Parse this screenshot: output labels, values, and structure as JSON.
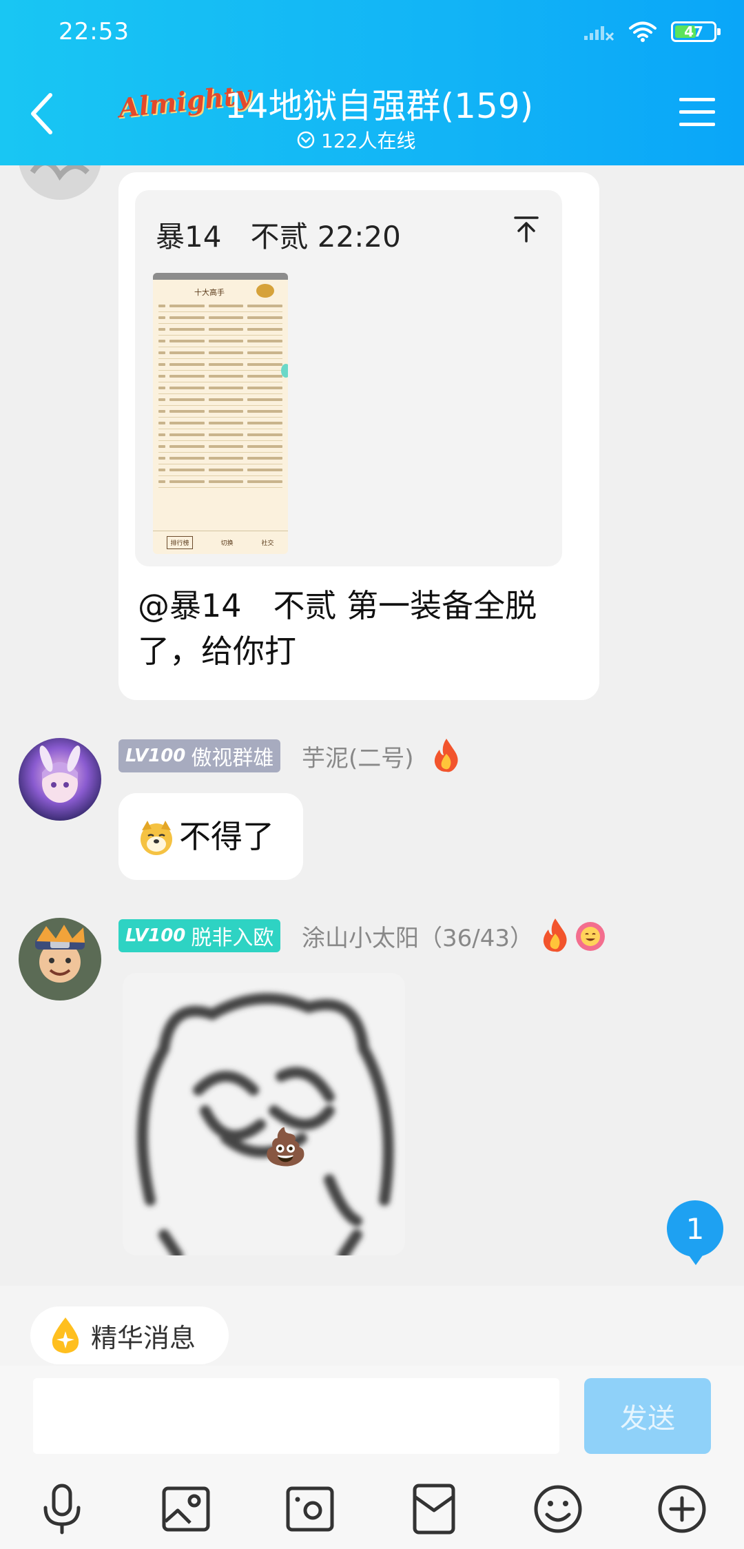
{
  "status_bar": {
    "time": "22:53",
    "battery": "47"
  },
  "header": {
    "group_logo_text": "Almighty",
    "group_name": "14地狱自强群(159)",
    "online_count": "122人在线"
  },
  "messages": {
    "reply": {
      "quoted_sender": "暴14　不贰 22:20",
      "thumbnail": {
        "title": "十大高手",
        "rows": [
          "",
          "",
          "",
          "",
          "",
          "",
          "",
          "",
          "",
          "",
          "",
          "",
          "",
          "",
          "",
          ""
        ],
        "footer": [
          "排行榜",
          "切换",
          "社交"
        ]
      },
      "text_line1": "@暴14　不贰 第一装备全脱",
      "text_line2": "了，给你打"
    },
    "msg2": {
      "level": "LV100",
      "title_badge": "傲视群雄",
      "nickname": "芋泥(二号)",
      "text": "不得了"
    },
    "msg3": {
      "level": "LV100",
      "title_badge": "脱非入欧",
      "nickname": "涂山小太阳（36/43）",
      "sticker_emoji": "💩"
    }
  },
  "unread_count": "1",
  "bottom": {
    "essence_label": "精华消息",
    "input_value": "",
    "input_placeholder": "",
    "send_label": "发送"
  },
  "colors": {
    "header_start": "#19c6f3",
    "header_end": "#0aa6f8",
    "badge_gray": "#a7abbf",
    "badge_teal": "#2ed3c3",
    "send_disabled": "#8fd1f9"
  }
}
